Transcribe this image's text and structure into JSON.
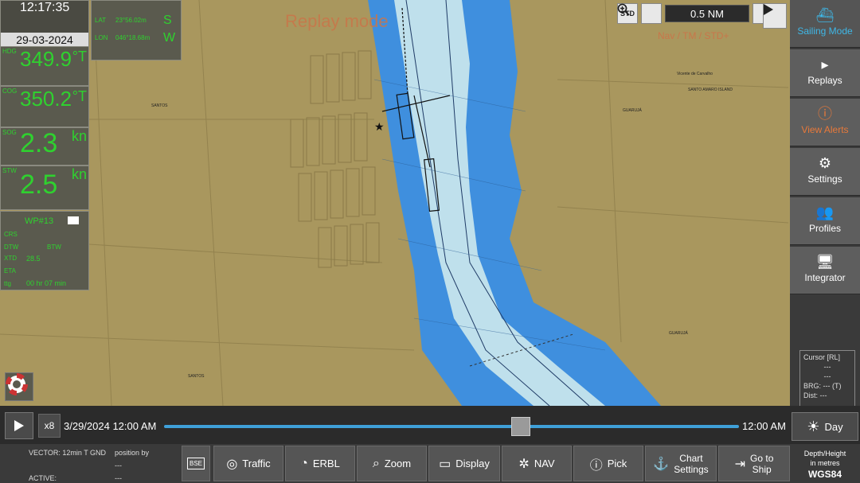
{
  "overlay": {
    "replay_title": "Replay mode",
    "nav_mode": "Nav / TM / STD+"
  },
  "zoom": {
    "std_label": "STD",
    "zoom_in_icon": "zoom-in-icon",
    "scale": "0.5 NM",
    "zoom_out_icon": "zoom-out-icon"
  },
  "time": {
    "clock": "12:17:35",
    "date": "29-03-2024"
  },
  "position": {
    "lat_label": "LAT",
    "lat_value": "23°56.02m",
    "lat_hemi": "S",
    "lon_label": "LON",
    "lon_value": "046°18.68m",
    "lon_hemi": "W"
  },
  "instruments": {
    "hdg_label": "HDG",
    "hdg_value": "349.9",
    "hdg_unit": "°T",
    "cog_label": "COG",
    "cog_value": "350.2",
    "cog_unit": "°T",
    "sog_label": "SOG",
    "sog_value": "2.3",
    "sog_unit": "kn",
    "stw_label": "STW",
    "stw_value": "2.5",
    "stw_unit": "kn"
  },
  "waypoint": {
    "wp_label": "WP#13",
    "crs_label": "CRS",
    "xtd_label": "XTD",
    "dtw_label": "DTW",
    "btw_label": "BTW",
    "ttg_label": "ttg",
    "ttg_value": "00 hr 07 min",
    "dtg_value": "28.5",
    "eta_label": "ETA"
  },
  "sidebar": {
    "sailing_mode": "Sailing Mode",
    "replays": "Replays",
    "view_alerts": "View Alerts",
    "settings": "Settings",
    "profiles": "Profiles",
    "integrator": "Integrator"
  },
  "cursor": {
    "title": "Cursor [RL]",
    "line1": "---",
    "line2": "---",
    "brg": "BRG: --- (T)",
    "dist": "Dist: ---"
  },
  "timeline": {
    "speed": "x8",
    "start": "3/29/2024 12:00 AM",
    "end": "12:00 AM",
    "progress": 0.62
  },
  "day_mode": "Day",
  "vector": {
    "vector_text": "VECTOR: 12min T GND",
    "position_by": "position by",
    "active": "ACTIVE:",
    "dashes": "---"
  },
  "toolbar": {
    "bse": "BSE",
    "traffic": "Traffic",
    "erbl": "ERBL",
    "zoom": "Zoom",
    "display": "Display",
    "nav": "NAV",
    "pick": "Pick",
    "chart_settings_1": "Chart",
    "chart_settings_2": "Settings",
    "goto_ship_1": "Go to",
    "goto_ship_2": "Ship"
  },
  "depth": {
    "line1": "Depth/Height",
    "line2": "in metres",
    "datum": "WGS84"
  },
  "chart_labels": {
    "santos": "SANTOS",
    "guaruja": "GUARUJÁ",
    "santo_amaro": "SANTO AMARO ISLAND",
    "vicente": "Vicente de Carvalho"
  }
}
